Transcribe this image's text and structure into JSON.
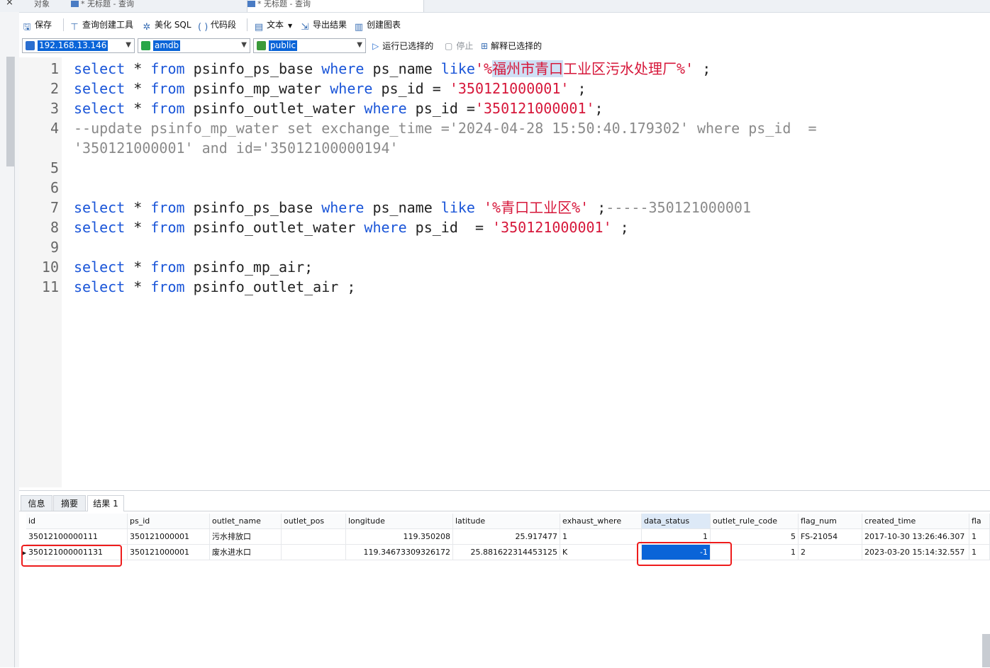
{
  "tabs": [
    {
      "label": "对象"
    },
    {
      "label": "* 无标题 - 查询"
    },
    {
      "label": "* 无标题 - 查询"
    }
  ],
  "toolbar": {
    "save": "保存",
    "query_builder": "查询创建工具",
    "beautify": "美化 SQL",
    "snippet": "代码段",
    "text": "文本",
    "export": "导出结果",
    "chart": "创建图表"
  },
  "selectors": {
    "connection": "192.168.13.146",
    "database": "amdb",
    "schema": "public",
    "run_selected": "运行已选择的",
    "stop": "停止",
    "explain": "解释已选择的"
  },
  "editor": {
    "lines": [
      {
        "n": "1",
        "segs": [
          {
            "c": "kw",
            "t": "select"
          },
          {
            "c": "",
            "t": " * "
          },
          {
            "c": "kw",
            "t": "from"
          },
          {
            "c": "",
            "t": " psinfo_ps_base "
          },
          {
            "c": "kw",
            "t": "where"
          },
          {
            "c": "",
            "t": " ps_name "
          },
          {
            "c": "kw",
            "t": "like"
          },
          {
            "c": "str",
            "t": "'%"
          },
          {
            "c": "str hl",
            "t": "福州市青口"
          },
          {
            "c": "str",
            "t": "工业区污水处理厂%'"
          },
          {
            "c": "",
            "t": " ;"
          }
        ]
      },
      {
        "n": "2",
        "segs": [
          {
            "c": "kw",
            "t": "select"
          },
          {
            "c": "",
            "t": " * "
          },
          {
            "c": "kw",
            "t": "from"
          },
          {
            "c": "",
            "t": " psinfo_mp_water "
          },
          {
            "c": "kw",
            "t": "where"
          },
          {
            "c": "",
            "t": " ps_id = "
          },
          {
            "c": "str",
            "t": "'350121000001'"
          },
          {
            "c": "",
            "t": " ;"
          }
        ]
      },
      {
        "n": "3",
        "segs": [
          {
            "c": "kw",
            "t": "select"
          },
          {
            "c": "",
            "t": " * "
          },
          {
            "c": "kw",
            "t": "from"
          },
          {
            "c": "",
            "t": " psinfo_outlet_water "
          },
          {
            "c": "kw",
            "t": "where"
          },
          {
            "c": "",
            "t": " ps_id ="
          },
          {
            "c": "str",
            "t": "'350121000001'"
          },
          {
            "c": "",
            "t": ";"
          }
        ]
      },
      {
        "n": "4",
        "segs": [
          {
            "c": "cmt",
            "t": "--update psinfo_mp_water set exchange_time ='2024-04-28 15:50:40.179302' where ps_id  ="
          }
        ]
      },
      {
        "n": "",
        "segs": [
          {
            "c": "cmt",
            "t": "'350121000001' and id='35012100000194'"
          }
        ]
      },
      {
        "n": "5",
        "segs": []
      },
      {
        "n": "6",
        "segs": []
      },
      {
        "n": "7",
        "segs": [
          {
            "c": "kw",
            "t": "select"
          },
          {
            "c": "",
            "t": " * "
          },
          {
            "c": "kw",
            "t": "from"
          },
          {
            "c": "",
            "t": " psinfo_ps_base "
          },
          {
            "c": "kw",
            "t": "where"
          },
          {
            "c": "",
            "t": " ps_name "
          },
          {
            "c": "kw",
            "t": "like"
          },
          {
            "c": "",
            "t": " "
          },
          {
            "c": "str",
            "t": "'%青口工业区%'"
          },
          {
            "c": "",
            "t": " ;"
          },
          {
            "c": "cmt",
            "t": "-----350121000001"
          }
        ]
      },
      {
        "n": "8",
        "segs": [
          {
            "c": "kw",
            "t": "select"
          },
          {
            "c": "",
            "t": " * "
          },
          {
            "c": "kw",
            "t": "from"
          },
          {
            "c": "",
            "t": " psinfo_outlet_water "
          },
          {
            "c": "kw",
            "t": "where"
          },
          {
            "c": "",
            "t": " ps_id  = "
          },
          {
            "c": "str",
            "t": "'350121000001'"
          },
          {
            "c": "",
            "t": " ;"
          }
        ]
      },
      {
        "n": "9",
        "segs": []
      },
      {
        "n": "10",
        "segs": [
          {
            "c": "kw",
            "t": "select"
          },
          {
            "c": "",
            "t": " * "
          },
          {
            "c": "kw",
            "t": "from"
          },
          {
            "c": "",
            "t": " psinfo_mp_air;"
          }
        ]
      },
      {
        "n": "11",
        "segs": [
          {
            "c": "kw",
            "t": "select"
          },
          {
            "c": "",
            "t": " * "
          },
          {
            "c": "kw",
            "t": "from"
          },
          {
            "c": "",
            "t": " psinfo_outlet_air ;"
          }
        ]
      }
    ]
  },
  "results": {
    "tabs": [
      "信息",
      "摘要",
      "结果 1"
    ],
    "columns": [
      "id",
      "ps_id",
      "outlet_name",
      "outlet_pos",
      "longitude",
      "latitude",
      "exhaust_where",
      "data_status",
      "outlet_rule_code",
      "flag_num",
      "created_time",
      "fla"
    ],
    "rows": [
      [
        "35012100000111",
        "350121000001",
        "污水排放口",
        "",
        "119.350208",
        "25.917477",
        "1",
        "1",
        "5",
        "FS-21054",
        "2017-10-30 13:26:46.307",
        "1"
      ],
      [
        "350121000001131",
        "350121000001",
        "废水进水口",
        "",
        "119.34673309326172",
        "25.881622314453125",
        "K",
        "-1",
        "1",
        "2",
        "2023-03-20 15:14:32.557",
        "1"
      ]
    ]
  }
}
